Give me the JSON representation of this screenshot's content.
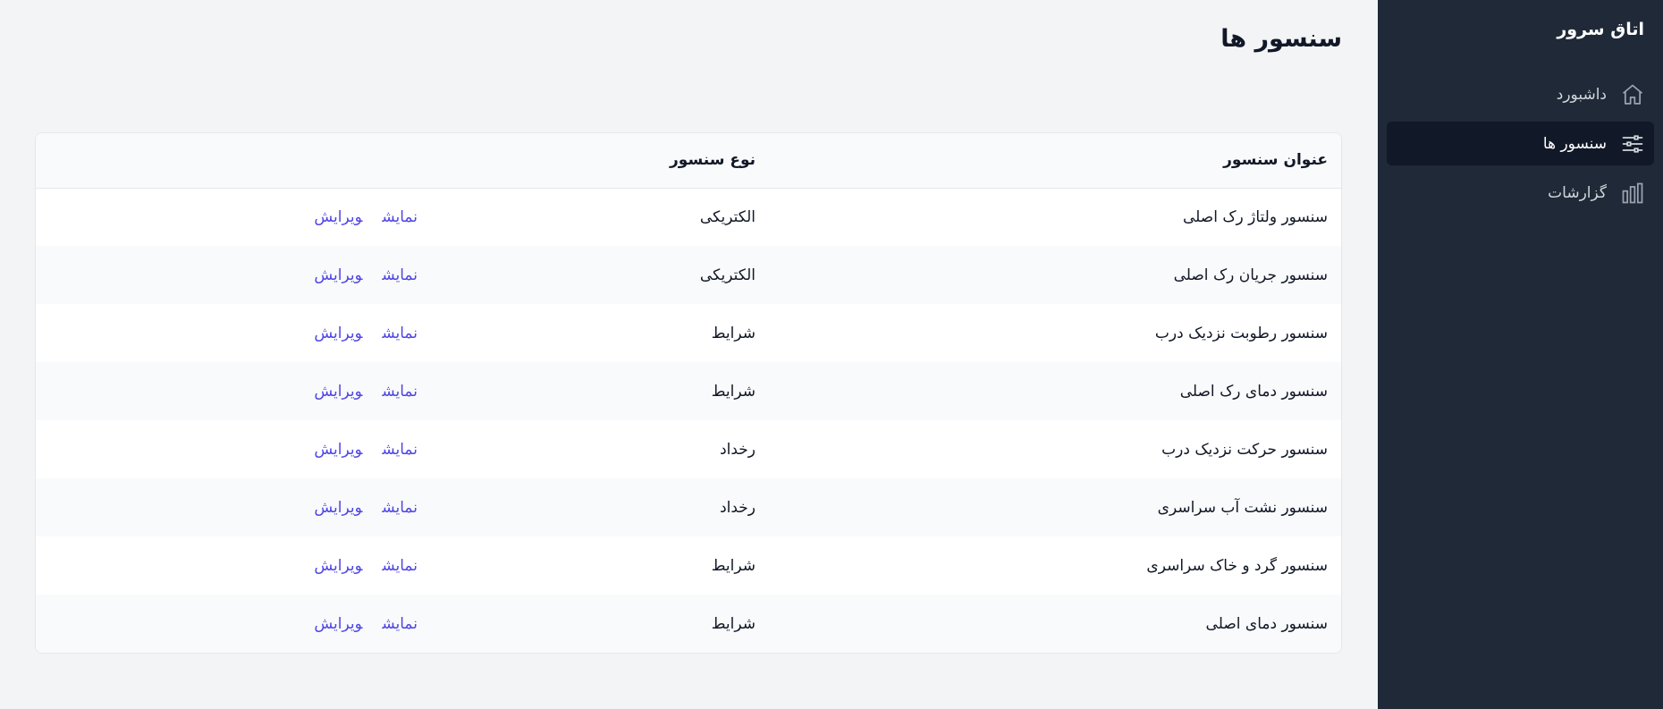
{
  "sidebar": {
    "brand": "اتاق سرور",
    "items": [
      {
        "label": "داشبورد",
        "icon": "home-icon",
        "active": false
      },
      {
        "label": "سنسور ها",
        "icon": "sliders-icon",
        "active": true
      },
      {
        "label": "گزارشات",
        "icon": "bar-chart-icon",
        "active": false
      }
    ]
  },
  "main": {
    "title": "سنسور ها",
    "table": {
      "headers": {
        "title": "عنوان سنسور",
        "type": "نوع سنسور"
      },
      "actions": {
        "show": "نمایش",
        "edit": "ویرایش"
      },
      "rows": [
        {
          "title": "سنسور ولتاژ رک اصلی",
          "type": "الکتریکی"
        },
        {
          "title": "سنسور جریان رک اصلی",
          "type": "الکتریکی"
        },
        {
          "title": "سنسور رطوبت نزدیک درب",
          "type": "شرایط"
        },
        {
          "title": "سنسور دمای رک اصلی",
          "type": "شرایط"
        },
        {
          "title": "سنسور حرکت نزدیک درب",
          "type": "رخداد"
        },
        {
          "title": "سنسور نشت آب سراسری",
          "type": "رخداد"
        },
        {
          "title": "سنسور گرد و خاک سراسری",
          "type": "شرایط"
        },
        {
          "title": "سنسور دمای اصلی",
          "type": "شرایط"
        }
      ]
    }
  },
  "colors": {
    "sidebar_bg": "#1f2937",
    "active_item_bg": "#111827",
    "link": "#4f46e5",
    "page_bg": "#f3f4f6"
  }
}
